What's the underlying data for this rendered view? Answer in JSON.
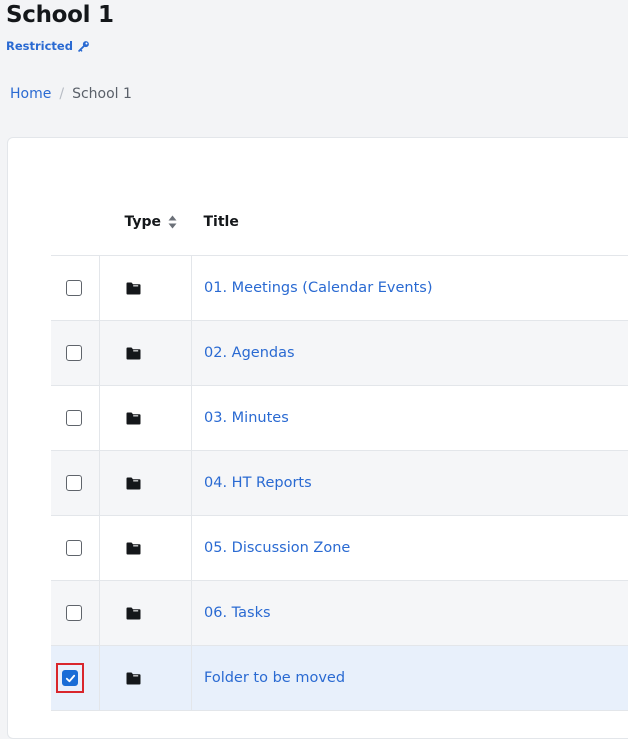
{
  "header": {
    "title": "School 1",
    "access_label": "Restricted"
  },
  "breadcrumb": {
    "home": "Home",
    "separator": "/",
    "current": "School 1"
  },
  "table": {
    "columns": {
      "type": "Type",
      "title": "Title"
    },
    "rows": [
      {
        "title": "01. Meetings (Calendar Events)",
        "checked": false
      },
      {
        "title": "02. Agendas",
        "checked": false
      },
      {
        "title": "03. Minutes",
        "checked": false
      },
      {
        "title": "04. HT Reports",
        "checked": false
      },
      {
        "title": "05. Discussion Zone",
        "checked": false
      },
      {
        "title": "06. Tasks",
        "checked": false
      },
      {
        "title": "Folder to be moved",
        "checked": true
      }
    ]
  },
  "colors": {
    "link": "#2a6ad2",
    "checkbox_checked": "#1a6dd6",
    "highlight_outline": "#d9262c"
  },
  "icons": {
    "access": "key-icon",
    "sort": "sort-icon",
    "row_type": "folder-icon"
  }
}
